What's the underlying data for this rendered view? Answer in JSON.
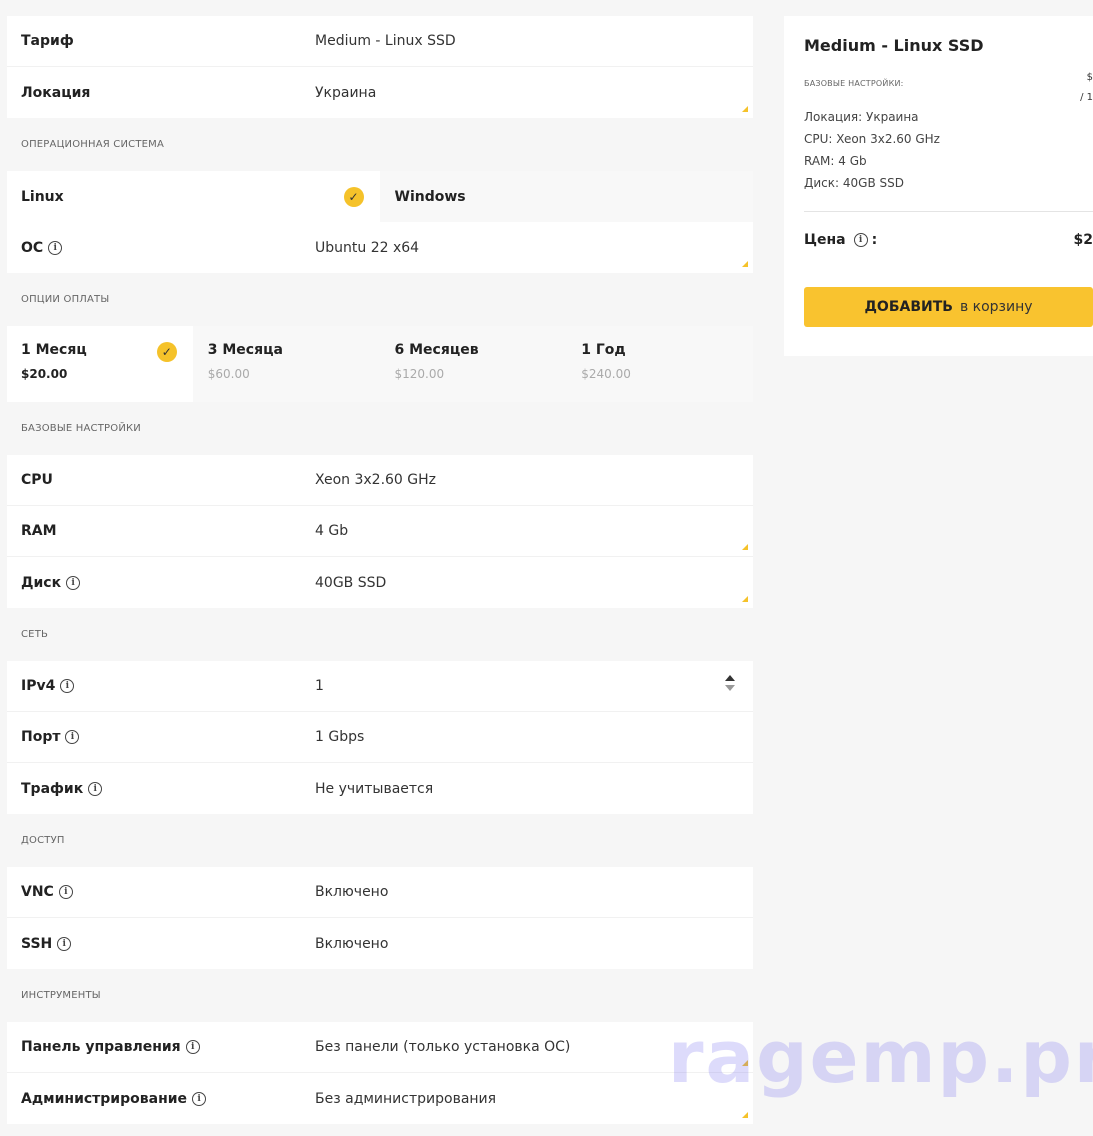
{
  "tariff": {
    "label": "Тариф",
    "value": "Medium - Linux SSD"
  },
  "location": {
    "label": "Локация",
    "value": "Украина"
  },
  "os_section": "ОПЕРАЦИОННАЯ СИСТЕМА",
  "os_options": [
    {
      "label": "Linux",
      "selected": true
    },
    {
      "label": "Windows",
      "selected": false
    }
  ],
  "os": {
    "label": "ОС",
    "value": "Ubuntu 22 x64"
  },
  "payment_section": "ОПЦИИ ОПЛАТЫ",
  "payment_options": [
    {
      "label": "1 Месяц",
      "price": "$20.00",
      "selected": true
    },
    {
      "label": "3 Месяца",
      "price": "$60.00",
      "selected": false
    },
    {
      "label": "6 Месяцев",
      "price": "$120.00",
      "selected": false
    },
    {
      "label": "1 Год",
      "price": "$240.00",
      "selected": false
    }
  ],
  "base_section": "БАЗОВЫЕ НАСТРОЙКИ",
  "cpu": {
    "label": "CPU",
    "value": "Xeon 3x2.60 GHz"
  },
  "ram": {
    "label": "RAM",
    "value": "4 Gb"
  },
  "disk": {
    "label": "Диск",
    "value": "40GB SSD"
  },
  "network_section": "СЕТЬ",
  "ipv4": {
    "label": "IPv4",
    "value": "1"
  },
  "port": {
    "label": "Порт",
    "value": "1 Gbps"
  },
  "traffic": {
    "label": "Трафик",
    "value": "Не учитывается"
  },
  "access_section": "ДОСТУП",
  "vnc": {
    "label": "VNC",
    "value": "Включено"
  },
  "ssh": {
    "label": "SSH",
    "value": "Включено"
  },
  "tools_section": "ИНСТРУМЕНТЫ",
  "panel": {
    "label": "Панель управления",
    "value": "Без панели (только установка ОС)"
  },
  "admin": {
    "label": "Администрирование",
    "value": "Без администрирования"
  },
  "summary": {
    "title": "Medium - Linux SSD",
    "section": "БАЗОВЫЕ НАСТРОЙКИ:",
    "side_price_top": "$",
    "side_price_bottom": "/ 1",
    "specs": [
      "Локация: Украина",
      "CPU: Xeon 3x2.60 GHz",
      "RAM: 4 Gb",
      "Диск: 40GB SSD"
    ],
    "price_label": "Цена",
    "price_colon": ":",
    "price_value": "$2",
    "add_bold": "ДОБАВИТЬ",
    "add_rest": "в корзину"
  },
  "info_glyph": "i",
  "check_glyph": "✓",
  "watermark": "ragemp.pro",
  "colors": {
    "accent": "#f9c32f",
    "background": "#f6f6f6"
  }
}
